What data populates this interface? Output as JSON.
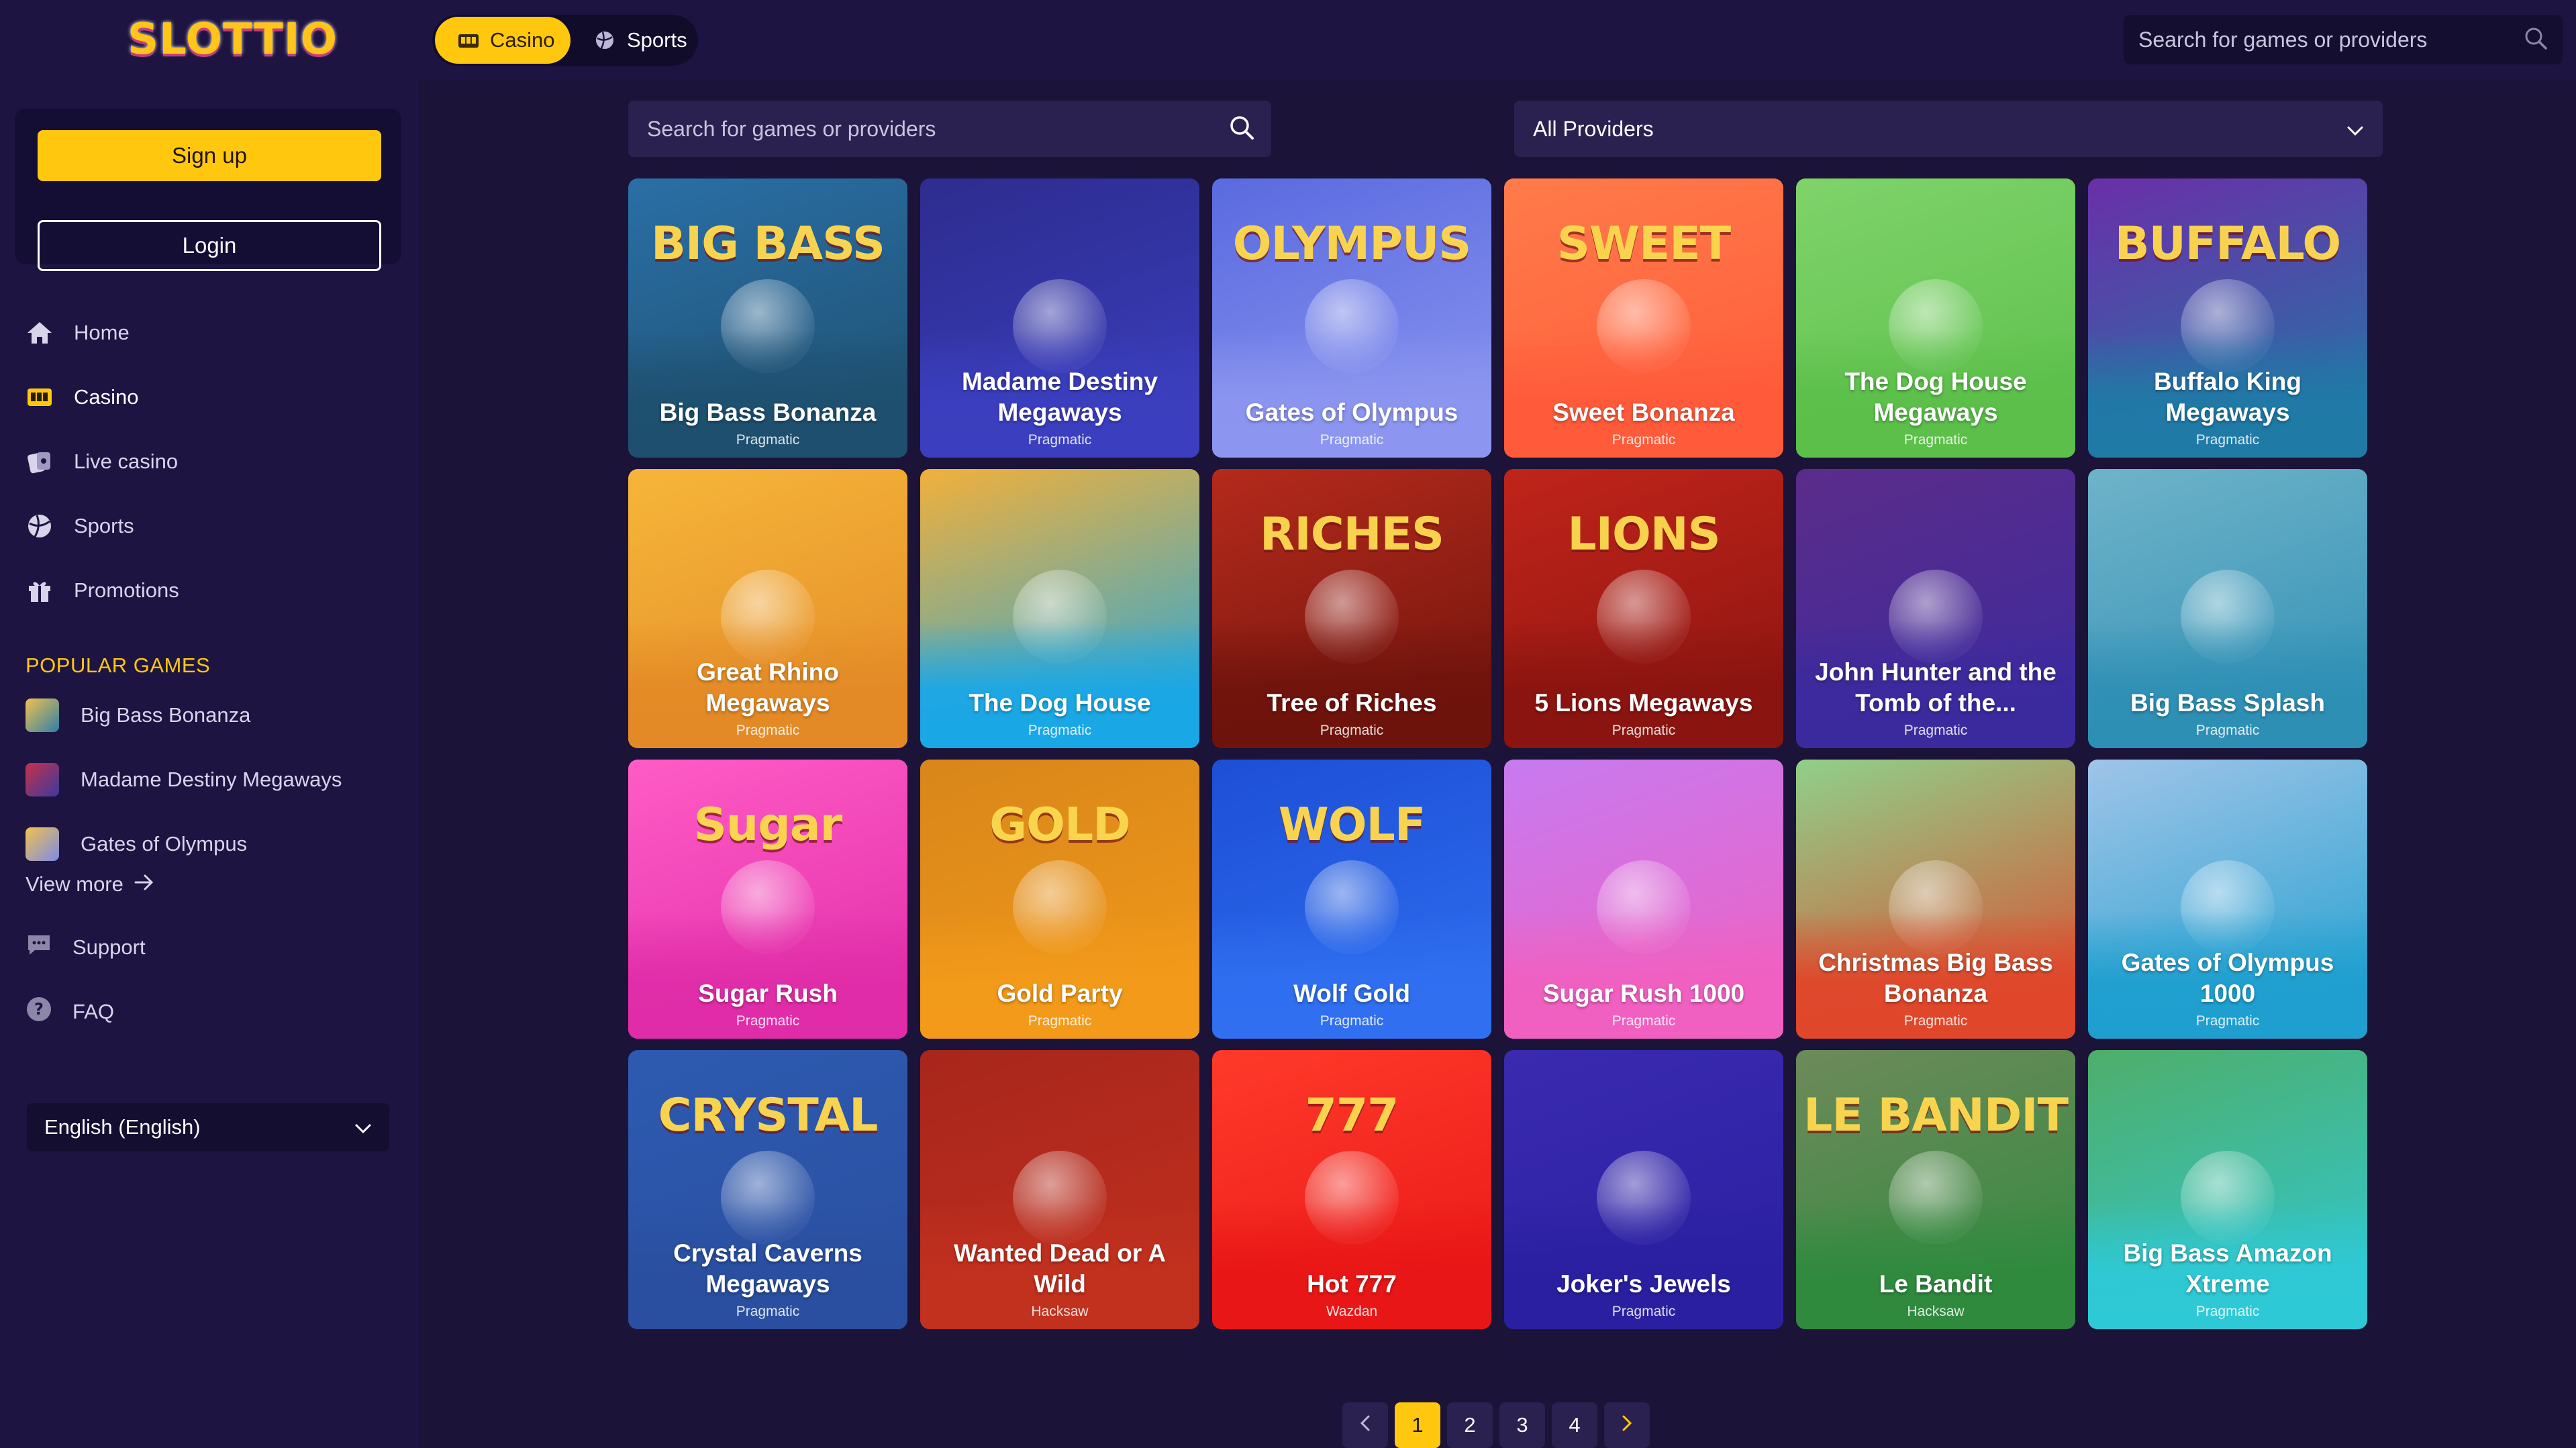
{
  "brand": {
    "logo_text": "SLOTTIO"
  },
  "topbar": {
    "modes": [
      {
        "label": "Casino",
        "icon": "slot-machine-icon",
        "active": true
      },
      {
        "label": "Sports",
        "icon": "ball-icon",
        "active": false
      }
    ],
    "search_placeholder": "Search for games or providers"
  },
  "auth": {
    "signup_label": "Sign up",
    "login_label": "Login"
  },
  "nav": [
    {
      "label": "Home",
      "icon": "home-icon"
    },
    {
      "label": "Casino",
      "icon": "slot-machine-icon"
    },
    {
      "label": "Live casino",
      "icon": "cards-icon"
    },
    {
      "label": "Sports",
      "icon": "ball-icon"
    },
    {
      "label": "Promotions",
      "icon": "gift-icon"
    }
  ],
  "popular": {
    "title": "POPULAR GAMES",
    "items": [
      {
        "label": "Big Bass Bonanza",
        "color": "#2f7fa8"
      },
      {
        "label": "Madame Destiny Megaways",
        "color": "#3a3a9e"
      },
      {
        "label": "Gates of Olympus",
        "color": "#7b8be8"
      }
    ],
    "view_more": "View more"
  },
  "support": [
    {
      "label": "Support",
      "icon": "chat-icon"
    },
    {
      "label": "FAQ",
      "icon": "question-icon"
    }
  ],
  "language": {
    "selected": "English (English)"
  },
  "main": {
    "search_placeholder": "Search for games or providers",
    "provider_selected": "All Providers"
  },
  "games": [
    {
      "title": "Big Bass Bonanza",
      "provider": "Pragmatic",
      "art": "BIG BASS",
      "c1": "#2a6fa6",
      "c2": "#1e4f6e"
    },
    {
      "title": "Madame Destiny Megaways",
      "provider": "Pragmatic",
      "art": "",
      "c1": "#2d2c8f",
      "c2": "#3b3fbf"
    },
    {
      "title": "Gates of Olympus",
      "provider": "Pragmatic",
      "art": "OLYMPUS",
      "c1": "#5a6be0",
      "c2": "#8c96f0"
    },
    {
      "title": "Sweet Bonanza",
      "provider": "Pragmatic",
      "art": "SWEET",
      "c1": "#ff7b4a",
      "c2": "#ff5a3a"
    },
    {
      "title": "The Dog House Megaways",
      "provider": "Pragmatic",
      "art": "",
      "c1": "#7fd36a",
      "c2": "#5bbf4a"
    },
    {
      "title": "Buffalo King Megaways",
      "provider": "Pragmatic",
      "art": "BUFFALO",
      "c1": "#6a2fa8",
      "c2": "#1f7aa6"
    },
    {
      "title": "Great Rhino Megaways",
      "provider": "Pragmatic",
      "art": "",
      "c1": "#f6b63a",
      "c2": "#e38a26"
    },
    {
      "title": "The Dog House",
      "provider": "Pragmatic",
      "art": "",
      "c1": "#f2b03a",
      "c2": "#19a7e6"
    },
    {
      "title": "Tree of Riches",
      "provider": "Pragmatic",
      "art": "RICHES",
      "c1": "#b52a1c",
      "c2": "#6e130c"
    },
    {
      "title": "5 Lions Megaways",
      "provider": "Pragmatic",
      "art": "LIONS",
      "c1": "#c0241a",
      "c2": "#8a1410"
    },
    {
      "title": "John Hunter and the Tomb of the...",
      "provider": "Pragmatic",
      "art": "",
      "c1": "#5b2c8a",
      "c2": "#3b2a9e"
    },
    {
      "title": "Big Bass Splash",
      "provider": "Pragmatic",
      "art": "",
      "c1": "#6fb3c9",
      "c2": "#2e8fb5"
    },
    {
      "title": "Sugar Rush",
      "provider": "Pragmatic",
      "art": "Sugar",
      "c1": "#ff5cc6",
      "c2": "#e02ca8"
    },
    {
      "title": "Gold Party",
      "provider": "Pragmatic",
      "art": "GOLD",
      "c1": "#d8861a",
      "c2": "#f39a1a"
    },
    {
      "title": "Wolf Gold",
      "provider": "Pragmatic",
      "art": "WOLF",
      "c1": "#1d4fd6",
      "c2": "#2f6ff0"
    },
    {
      "title": "Sugar Rush 1000",
      "provider": "Pragmatic",
      "art": "",
      "c1": "#c77af0",
      "c2": "#f060c0"
    },
    {
      "title": "Christmas Big Bass Bonanza",
      "provider": "Pragmatic",
      "art": "",
      "c1": "#8fd08a",
      "c2": "#e0462a"
    },
    {
      "title": "Gates of Olympus 1000",
      "provider": "Pragmatic",
      "art": "",
      "c1": "#9fc4e8",
      "c2": "#1e9fcf"
    },
    {
      "title": "Crystal Caverns Megaways",
      "provider": "Pragmatic",
      "art": "CRYSTAL",
      "c1": "#2d5ab0",
      "c2": "#2a4fa0"
    },
    {
      "title": "Wanted Dead or A Wild",
      "provider": "Hacksaw",
      "art": "",
      "c1": "#a8261c",
      "c2": "#c2301e"
    },
    {
      "title": "Hot 777",
      "provider": "Wazdan",
      "art": "777",
      "c1": "#ff3a2a",
      "c2": "#e81616"
    },
    {
      "title": "Joker's Jewels",
      "provider": "Pragmatic",
      "art": "",
      "c1": "#3a2ab0",
      "c2": "#2a1fa0"
    },
    {
      "title": "Le Bandit",
      "provider": "Hacksaw",
      "art": "LE BANDIT",
      "c1": "#6d8a5a",
      "c2": "#2f8a3e"
    },
    {
      "title": "Big Bass Amazon Xtreme",
      "provider": "Pragmatic",
      "art": "",
      "c1": "#4fae6a",
      "c2": "#2ec9d6"
    }
  ],
  "pagination": {
    "pages": [
      "1",
      "2",
      "3",
      "4"
    ],
    "current": "1"
  }
}
